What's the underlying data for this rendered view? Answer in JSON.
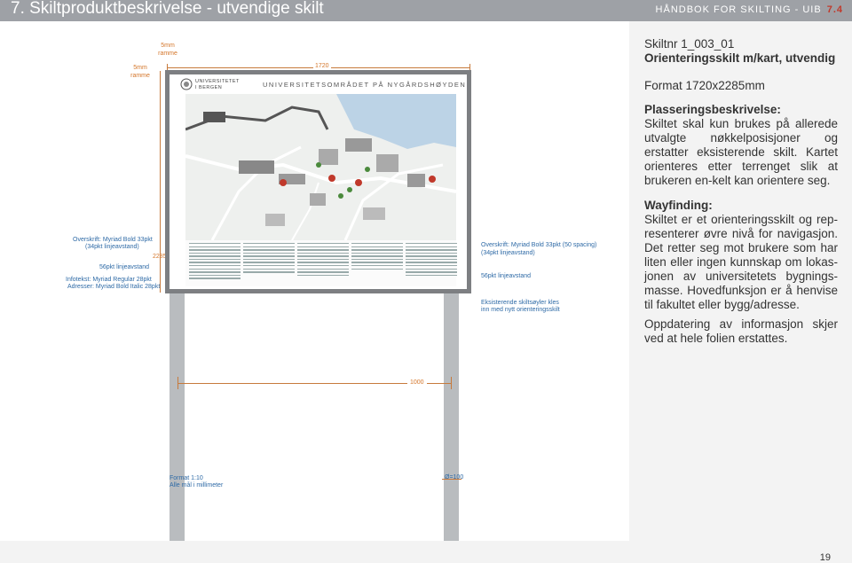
{
  "header": {
    "title": "7. Skiltproduktbeskrivelse - utvendige skilt",
    "right_label": "HÅNDBOK  FOR SKILTING - UIB",
    "right_number": "7.4"
  },
  "sidebar": {
    "sign_number": "Skiltnr 1_003_01",
    "sign_type": "Orienteringsskilt m/kart, utvendig",
    "format": "Format 1720x2285mm",
    "placement_heading": "Plasseringsbeskrivelse:",
    "placement_text": "Skiltet skal kun brukes på allerede utvalgte nøkkelposisjoner og erstatter eksisterende skilt. Kartet orienteres etter terrenget slik at brukeren en-kelt kan orientere seg.",
    "wayfinding_heading": "Wayfinding:",
    "wayfinding_text": "Skiltet er et orienteringsskilt og rep-resenterer øvre nivå for navigasjon. Det retter seg mot brukere som har liten eller ingen kunnskap om lokas-jonen av universitetets bygnings-masse. Hovedfunksjon er å henvise til fakultet eller bygg/adresse.",
    "update_text": "Oppdatering av informasjon skjer ved at hele folien erstattes."
  },
  "drawing": {
    "frame_left": "5mm ramme",
    "frame_top": "5mm ramme",
    "width_label": "1720",
    "height_label": "2285",
    "leg_spacing": "1000",
    "post_diameter": "Ø=100",
    "scale_line1": "Format 1:10",
    "scale_line2": "Alle mål i millimeter",
    "left_ann1": "Overskrift: Myriad Bold 33pkt",
    "left_ann2": "(34pkt linjeavstand)",
    "left_ann3": "56pkt linjeavstand",
    "left_ann4": "Infotekst: Myriad Regular 28pkt",
    "left_ann5": "Adresser: Myriad Bold Italic 28pkt",
    "right_ann1": "Overskrift: Myriad Bold 33pkt (50 spacing)",
    "right_ann2": "(34pkt linjeavstand)",
    "right_ann3": "56pkt linjeavstand",
    "right_ann4": "Eksisterende skiltsøyler kles",
    "right_ann5": "inn med nytt orienteringsskilt"
  },
  "sign": {
    "logo_line1": "UNIVERSITETET",
    "logo_line2": "I BERGEN",
    "title": "UNIVERSITETSOMRÅDET PÅ NYGÅRDSHØYDEN"
  },
  "colors": {
    "header": "#9ea1a6",
    "accent": "#c0392b",
    "annotation": "#d4762a",
    "frame": "#7d7f82"
  },
  "page_number": "19"
}
